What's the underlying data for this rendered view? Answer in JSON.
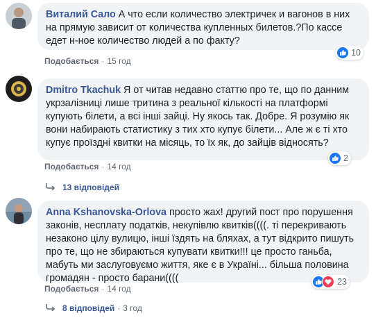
{
  "comments": [
    {
      "author": "Виталий Сало",
      "text": "А что если количество электричек и вагонов в них на прямую зависит от количества купленных билетов.?По кассе едет н-ное количество людей а по факту?",
      "like_label": "Подобається",
      "time": "15 год",
      "reaction_count": "10"
    },
    {
      "author": "Dmitro Tkachuk",
      "text": "Я от читав недавно статтю про те, що по данним укрзалізниці лише тритина з реальної кількості на платформі купують білети, а всі інші зайці. Ну якось так. Добре. Я розумію як вони набирають статистику з тих хто купує білети... Але ж є ті хто купує проїздні квитки на місяць, то їх як, до зайців відносять?",
      "like_label": "Подобається",
      "time": "14 год",
      "reaction_count": "2",
      "replies": "13 відповідей"
    },
    {
      "author": "Anna Kshanovska-Orlova",
      "text": "просто жах! другий пост про порушення законів, несплату податків, некупівлю квитків((((. ті перекривають незаконо цілу вулицю, інші їздять на бляхах, а тут відкрито пишуть про те, що не збираються купувати квитки!!! це просто ганьба, мабуть ми заслуговуємо життя, яке є в Україні... більша половина громадян - просто барани((((",
      "like_label": "Подобається",
      "time": "14 год",
      "reaction_count": "23",
      "replies": "8 відповідей",
      "replies_time": "3 год"
    }
  ],
  "colors": {
    "author": "#385898",
    "bubble": "#f2f3f5",
    "like": "#1877f2",
    "love": "#f33e58"
  },
  "icons": [
    "like-icon",
    "love-icon",
    "reply-arrow-icon"
  ]
}
